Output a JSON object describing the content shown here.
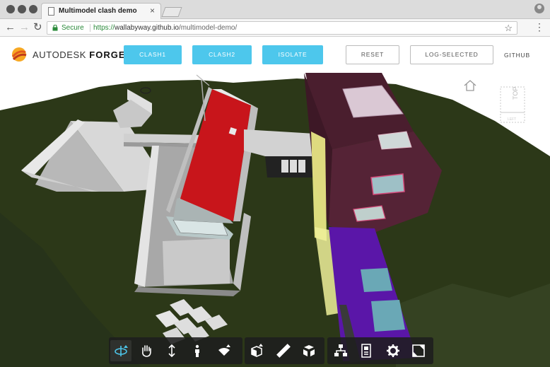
{
  "browser": {
    "tab_title": "Multimodel clash demo",
    "tab_close": "×",
    "secure_label": "Secure",
    "url_scheme": "https://",
    "url_host": "wallabyway.github.io",
    "url_path": "/multimodel-demo/",
    "back": "←",
    "forward": "→",
    "reload": "↻",
    "star": "☆",
    "menu": "⋮"
  },
  "app": {
    "logo_autodesk": "AUTODESK",
    "logo_forge": "FORGE",
    "buttons": {
      "clash1": "CLASH1",
      "clash2": "CLASH2",
      "isolate": "ISOLATE",
      "reset": "RESET",
      "log_selected": "LOG-SELECTED"
    },
    "github": "GITHUB"
  },
  "viewer": {
    "colors": {
      "sky": "#ffffff",
      "ground": "#2f3a1a",
      "roof": "#c8151b",
      "brick": "#4a1e2e",
      "glass_yellow": "#f0f08a",
      "glass_purple": "#5a16a8",
      "concrete": "#9a9a9a"
    },
    "viewcube_face": "TOP",
    "viewcube_side": "LEFT",
    "toolbar_icons": [
      "orbit-icon",
      "pan-icon",
      "dolly-icon",
      "first-person-icon",
      "camera-icon",
      "section-icon",
      "measure-icon",
      "explode-icon",
      "model-browser-icon",
      "properties-icon",
      "settings-icon",
      "fullscreen-icon"
    ]
  }
}
